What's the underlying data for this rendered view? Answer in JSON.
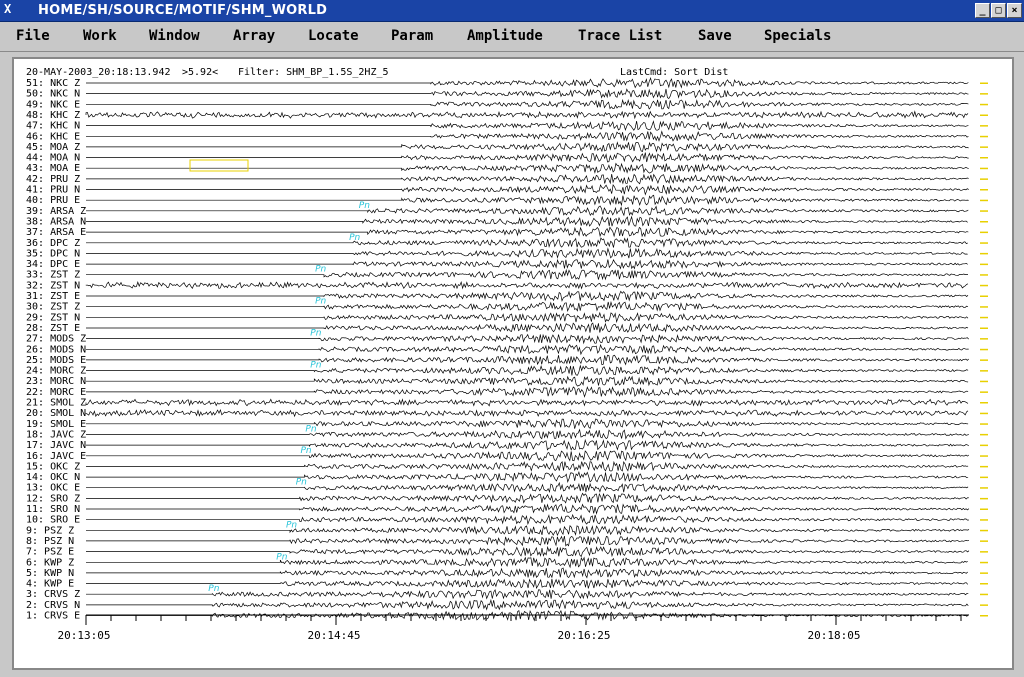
{
  "window": {
    "title": "HOME/SH/SOURCE/MOTIF/SHM_WORLD",
    "logo": "X",
    "buttons": [
      "minimize-icon",
      "maximize-icon",
      "close-icon"
    ],
    "title_color": "#1a44a6"
  },
  "menu": [
    "File",
    "Work",
    "Window",
    "Array",
    "Locate",
    "Param",
    "Amplitude",
    "Trace List",
    "Save",
    "Specials"
  ],
  "status": {
    "datetime": "20-MAY-2003_20:18:13.942",
    "window_marker": ">5.92<",
    "filter": "Filter: SHM_BP_1.5S_2HZ_5",
    "last_cmd": "LastCmd: Sort Dist"
  },
  "traces": [
    "51: NKC Z",
    "50: NKC N",
    "49: NKC E",
    "48: KHC Z",
    "47: KHC N",
    "46: KHC E",
    "45: MOA Z",
    "44: MOA N",
    "43: MOA E",
    "42: PRU Z",
    "41: PRU N",
    "40: PRU E",
    "39: ARSA Z",
    "38: ARSA N",
    "37: ARSA E",
    "36: DPC Z",
    "35: DPC N",
    "34: DPC E",
    "33: ZST Z",
    "32: ZST N",
    "31: ZST E",
    "30: ZST Z",
    "29: ZST N",
    "28: ZST E",
    "27: MODS Z",
    "26: MODS N",
    "25: MODS E",
    "24: MORC Z",
    "23: MORC N",
    "22: MORC E",
    "21: SMOL Z",
    "20: SMOL N",
    "19: SMOL E",
    "18: JAVC Z",
    "17: JAVC N",
    "16: JAVC E",
    "15: OKC Z",
    "14: OKC N",
    "13: OKC E",
    "12: SRO Z",
    "11: SRO N",
    "10: SRO E",
    "9: PSZ Z",
    "8: PSZ N",
    "7: PSZ E",
    "6: KWP Z",
    "5: KWP N",
    "4: KWP E",
    "3: CRVS Z",
    "2: CRVS N",
    "1: CRVS E"
  ],
  "onsets": [
    0.71,
    0.71,
    0.71,
    0.0,
    0.71,
    0.71,
    0.65,
    0.65,
    0.65,
    0.65,
    0.65,
    0.65,
    0.58,
    0.57,
    0.58,
    0.55,
    0.55,
    0.55,
    0.49,
    0.0,
    0.49,
    0.49,
    0.49,
    0.49,
    0.48,
    0.48,
    0.48,
    0.47,
    0.47,
    0.47,
    0.0,
    0.0,
    0.47,
    0.46,
    0.46,
    0.46,
    0.45,
    0.45,
    0.45,
    0.44,
    0.44,
    0.44,
    0.42,
    0.42,
    0.42,
    0.4,
    0.4,
    0.4,
    0.26,
    0.26,
    0.26
  ],
  "phase_label": "Pn",
  "phase_picks": [
    {
      "trace": 12,
      "t": 0.57
    },
    {
      "trace": 15,
      "t": 0.55
    },
    {
      "trace": 18,
      "t": 0.48
    },
    {
      "trace": 21,
      "t": 0.48
    },
    {
      "trace": 24,
      "t": 0.47
    },
    {
      "trace": 27,
      "t": 0.47
    },
    {
      "trace": 33,
      "t": 0.46
    },
    {
      "trace": 35,
      "t": 0.45
    },
    {
      "trace": 38,
      "t": 0.44
    },
    {
      "trace": 42,
      "t": 0.42
    },
    {
      "trace": 45,
      "t": 0.4
    },
    {
      "trace": 48,
      "t": 0.26
    }
  ],
  "time_axis": {
    "labels": [
      "20:13:05",
      "20:14:45",
      "20:16:25",
      "20:18:05"
    ]
  },
  "colors": {
    "pick": "#27c3d8",
    "marker": "#e8d000",
    "trace": "#000000"
  }
}
